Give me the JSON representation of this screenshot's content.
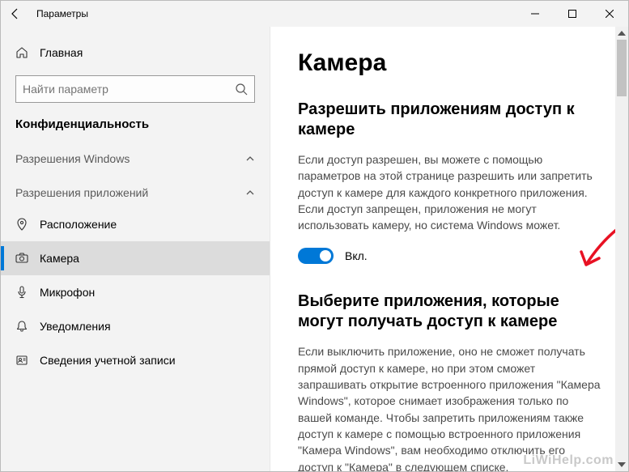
{
  "titlebar": {
    "title": "Параметры"
  },
  "sidebar": {
    "home": "Главная",
    "search_placeholder": "Найти параметр",
    "category": "Конфиденциальность",
    "section_windows": "Разрешения Windows",
    "section_apps": "Разрешения приложений",
    "items": [
      {
        "label": "Расположение"
      },
      {
        "label": "Камера"
      },
      {
        "label": "Микрофон"
      },
      {
        "label": "Уведомления"
      },
      {
        "label": "Сведения учетной записи"
      }
    ]
  },
  "main": {
    "title": "Камера",
    "allow_heading": "Разрешить приложениям доступ к камере",
    "allow_desc": "Если доступ разрешен, вы можете с помощью параметров на этой странице разрешить или запретить доступ к камере для каждого конкретного приложения. Если доступ запрещен, приложения не могут использовать камеру, но система Windows может.",
    "toggle_label": "Вкл.",
    "choose_heading": "Выберите приложения, которые могут получать доступ к камере",
    "choose_desc": "Если выключить приложение, оно не сможет получать прямой доступ к камере, но при этом сможет запрашивать открытие встроенного приложения \"Камера Windows\", которое снимает изображения только по вашей команде. Чтобы запретить приложениям также доступ к камере с помощью встроенного приложения \"Камера Windows\", вам необходимо отключить его доступ к \"Камера\" в следующем списке."
  },
  "watermark": "LiWiHelp.com"
}
